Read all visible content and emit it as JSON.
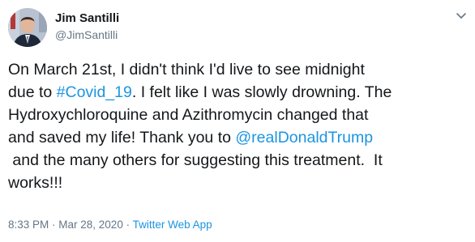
{
  "author": {
    "name": "Jim Santilli",
    "handle": "@JimSantilli"
  },
  "tweet": {
    "lines": [
      {
        "before": "On March 21st, I didn't think I'd live to see midnight",
        "link": "",
        "after": ""
      },
      {
        "before": "due to ",
        "link": "#Covid_19",
        "after": ". I felt like I was slowly drowning. The"
      },
      {
        "before": "Hydroxychloroquine and Azithromycin changed that",
        "link": "",
        "after": ""
      },
      {
        "before": "and saved my life! Thank you to ",
        "link": "@realDonaldTrump",
        "after": ""
      },
      {
        "before": " and the many others for suggesting this treatment.  It",
        "link": "",
        "after": ""
      },
      {
        "before": "works!!!",
        "link": "",
        "after": ""
      }
    ]
  },
  "meta": {
    "time": "8:33 PM · Mar 28, 2020",
    "separator": " · ",
    "source": "Twitter Web App"
  },
  "colors": {
    "link": "#1b95e0",
    "secondary": "#657786",
    "text": "#14171a"
  },
  "icons": {
    "menu": "chevron-down-icon"
  }
}
